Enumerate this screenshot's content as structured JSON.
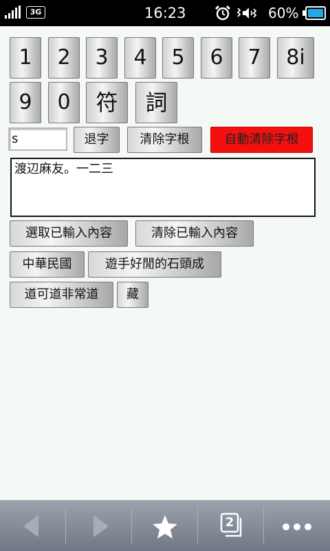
{
  "status": {
    "network": "3G",
    "time": "16:23",
    "battery": "60%"
  },
  "keys_row1": [
    "1",
    "2",
    "3",
    "4",
    "5",
    "6",
    "7",
    "8i"
  ],
  "keys_row2": [
    "9",
    "0",
    "符",
    "詞"
  ],
  "input": {
    "value": "s"
  },
  "controls": {
    "backspace": "退字",
    "clear_radicals": "清除字根",
    "auto_clear": "自動清除字根"
  },
  "textarea": {
    "value": "渡辺麻友。一二三"
  },
  "actions": {
    "select_input": "選取已輸入內容",
    "clear_input": "清除已輸入內容"
  },
  "phrases": [
    "中華民國",
    "遊手好閒的石頭成",
    "道可道非常道",
    "藏"
  ],
  "toolbar": {
    "tab_count": "2"
  },
  "colors": {
    "accent_red": "#f51010",
    "battery_blue": "#23a8e8"
  }
}
